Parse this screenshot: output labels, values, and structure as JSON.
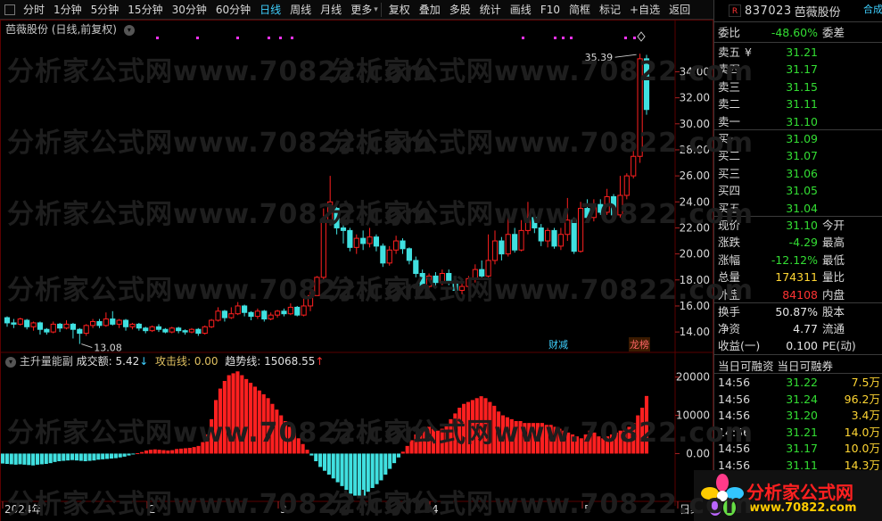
{
  "toolbar": {
    "left_items": [
      "分时",
      "1分钟",
      "5分钟",
      "15分钟",
      "30分钟",
      "60分钟",
      "日线",
      "周线",
      "月线",
      "更多"
    ],
    "active": "日线",
    "right_items": [
      "复权",
      "叠加",
      "多股",
      "统计",
      "画线",
      "F10",
      "简框",
      "标记",
      "+自选",
      "返回"
    ]
  },
  "chart": {
    "title": "芭薇股份 (日线,前复权)",
    "high_label": "35.39",
    "low_label": "13.08",
    "y_ticks": [
      "34.00",
      "32.00",
      "30.00",
      "28.00",
      "26.00",
      "24.00",
      "22.00",
      "20.00",
      "18.00",
      "16.00",
      "14.00"
    ],
    "x_ticks": [
      "2024年",
      "2",
      "3",
      "4",
      "5",
      "日线"
    ],
    "marker_cw": "财减",
    "marker_lb": "龙榜",
    "watermark": "分析家公式网www.70822.com"
  },
  "indicator": {
    "name": "主升量能副",
    "volume_label": "成交额:",
    "volume_value": "5.42",
    "attack_label": "攻击线:",
    "attack_value": "0.00",
    "trend_label": "趋势线:",
    "trend_value": "15068.55",
    "y_ticks": [
      "20000",
      "10000",
      "0.00"
    ]
  },
  "panel": {
    "badge": "R",
    "code": "837023",
    "name": "芭薇股份",
    "tag": "合成",
    "weibi_label": "委比",
    "weibi_value": "-48.60%",
    "weicha_label": "委差",
    "sells": [
      {
        "label": "卖五",
        "price": "31.21"
      },
      {
        "label": "卖四",
        "price": "31.17"
      },
      {
        "label": "卖三",
        "price": "31.15"
      },
      {
        "label": "卖二",
        "price": "31.11"
      },
      {
        "label": "卖一",
        "price": "31.10"
      }
    ],
    "sell5_currency": "¥",
    "buys": [
      {
        "label": "买一",
        "price": "31.09"
      },
      {
        "label": "买二",
        "price": "31.07"
      },
      {
        "label": "买三",
        "price": "31.06"
      },
      {
        "label": "买四",
        "price": "31.05"
      },
      {
        "label": "买五",
        "price": "31.04"
      }
    ],
    "stats": [
      {
        "label": "现价",
        "value": "31.10",
        "color": "green",
        "label2": "今开"
      },
      {
        "label": "涨跌",
        "value": "-4.29",
        "color": "green",
        "label2": "最高"
      },
      {
        "label": "涨幅",
        "value": "-12.12%",
        "color": "green",
        "label2": "最低"
      },
      {
        "label": "总量",
        "value": "174311",
        "color": "yellow",
        "label2": "量比"
      },
      {
        "label": "外盘",
        "value": "84108",
        "color": "red",
        "label2": "内盘"
      }
    ],
    "stats2": [
      {
        "label": "换手",
        "value": "50.87%",
        "color": "white",
        "label2": "股本"
      },
      {
        "label": "净资",
        "value": "4.77",
        "color": "white",
        "label2": "流通"
      },
      {
        "label": "收益(一)",
        "value": "0.100",
        "color": "white",
        "label2": "PE(动)"
      }
    ],
    "fin_head": "当日可融资 当日可融券",
    "ticks": [
      {
        "time": "14:56",
        "price": "31.22",
        "vol": "7.5万"
      },
      {
        "time": "14:56",
        "price": "31.24",
        "vol": "96.2万"
      },
      {
        "time": "14:56",
        "price": "31.20",
        "vol": "3.4万"
      },
      {
        "time": "14:56",
        "price": "31.21",
        "vol": "14.0万"
      },
      {
        "time": "14:56",
        "price": "31.17",
        "vol": "10.0万"
      },
      {
        "time": "14:56",
        "price": "31.11",
        "vol": "14.3万"
      }
    ],
    "logo_main": "分析家公式网",
    "logo_sub": "www.70822.com"
  },
  "colors": {
    "up": "#ff2020",
    "down": "#40e0e0",
    "bg": "#000000",
    "grid": "#3a0000"
  },
  "chart_data": {
    "type": "candlestick+bar",
    "price_range": [
      12.5,
      36.5
    ],
    "candles": [
      [
        15.1,
        14.7,
        15.2,
        14.4
      ],
      [
        14.7,
        14.6,
        15.0,
        14.3
      ],
      [
        14.6,
        15.0,
        15.1,
        14.5
      ],
      [
        14.9,
        14.4,
        15.0,
        14.2
      ],
      [
        14.4,
        14.7,
        14.8,
        14.1
      ],
      [
        14.7,
        14.2,
        14.8,
        13.8
      ],
      [
        14.2,
        14.0,
        14.3,
        13.8
      ],
      [
        14.0,
        14.6,
        14.8,
        13.9
      ],
      [
        14.6,
        14.3,
        14.7,
        14.0
      ],
      [
        14.3,
        14.6,
        14.9,
        14.2
      ],
      [
        14.6,
        14.2,
        14.7,
        13.5
      ],
      [
        14.2,
        13.9,
        14.3,
        13.08
      ],
      [
        13.9,
        14.5,
        14.6,
        13.7
      ],
      [
        14.5,
        14.8,
        15.0,
        14.3
      ],
      [
        14.8,
        14.5,
        15.0,
        14.3
      ],
      [
        14.5,
        15.0,
        15.5,
        14.4
      ],
      [
        15.0,
        14.6,
        15.6,
        14.5
      ],
      [
        14.6,
        14.9,
        15.0,
        14.3
      ],
      [
        14.9,
        14.4,
        15.0,
        14.1
      ],
      [
        14.4,
        14.6,
        14.7,
        14.2
      ],
      [
        14.6,
        14.3,
        14.7,
        14.1
      ],
      [
        14.3,
        14.1,
        14.4,
        13.9
      ],
      [
        14.1,
        14.4,
        14.5,
        14.0
      ],
      [
        14.4,
        14.2,
        14.6,
        14.0
      ],
      [
        14.2,
        14.0,
        14.3,
        13.9
      ],
      [
        14.0,
        14.3,
        14.4,
        13.9
      ],
      [
        14.3,
        14.1,
        14.4,
        13.9
      ],
      [
        14.1,
        14.0,
        14.2,
        13.8
      ],
      [
        14.0,
        14.2,
        14.3,
        13.9
      ],
      [
        14.2,
        13.9,
        14.3,
        13.7
      ],
      [
        13.9,
        14.4,
        14.5,
        13.8
      ],
      [
        14.4,
        14.9,
        15.0,
        14.3
      ],
      [
        14.9,
        15.6,
        15.9,
        14.8
      ],
      [
        15.6,
        15.1,
        15.7,
        14.8
      ],
      [
        15.1,
        15.4,
        15.9,
        15.0
      ],
      [
        15.4,
        16.0,
        16.3,
        15.3
      ],
      [
        16.0,
        15.5,
        16.1,
        15.2
      ],
      [
        15.5,
        15.2,
        15.6,
        14.9
      ],
      [
        15.2,
        15.6,
        15.8,
        15.0
      ],
      [
        15.6,
        15.0,
        15.7,
        14.8
      ],
      [
        15.0,
        15.3,
        15.5,
        14.9
      ],
      [
        15.3,
        15.6,
        15.7,
        15.1
      ],
      [
        15.6,
        15.4,
        15.8,
        15.2
      ],
      [
        15.4,
        15.9,
        16.2,
        15.3
      ],
      [
        15.9,
        15.3,
        16.0,
        15.2
      ],
      [
        15.3,
        16.0,
        16.6,
        15.2
      ],
      [
        16.0,
        16.8,
        17.2,
        15.6
      ],
      [
        16.8,
        18.2,
        18.3,
        16.8
      ],
      [
        18.2,
        22.5,
        23.5,
        18.0
      ],
      [
        22.5,
        24.0,
        26.0,
        22.2
      ],
      [
        23.5,
        22.0,
        23.6,
        21.5
      ],
      [
        22.0,
        21.8,
        22.3,
        20.8
      ],
      [
        21.8,
        20.5,
        22.0,
        20.2
      ],
      [
        20.5,
        21.2,
        21.5,
        20.0
      ],
      [
        21.2,
        20.8,
        21.8,
        20.3
      ],
      [
        20.8,
        21.3,
        22.0,
        20.5
      ],
      [
        21.3,
        20.6,
        21.5,
        20.2
      ],
      [
        20.6,
        19.3,
        20.8,
        19.0
      ],
      [
        19.3,
        20.3,
        20.6,
        19.1
      ],
      [
        20.3,
        21.0,
        21.4,
        20.0
      ],
      [
        21.0,
        20.4,
        21.2,
        20.0
      ],
      [
        20.4,
        19.5,
        20.5,
        19.2
      ],
      [
        19.5,
        18.5,
        19.8,
        18.2
      ],
      [
        18.5,
        17.5,
        18.8,
        17.2
      ],
      [
        17.5,
        18.3,
        18.5,
        17.3
      ],
      [
        18.3,
        17.8,
        18.6,
        17.5
      ],
      [
        17.8,
        18.5,
        18.8,
        17.6
      ],
      [
        18.5,
        17.9,
        18.8,
        17.6
      ],
      [
        17.9,
        17.2,
        18.0,
        17.0
      ],
      [
        17.2,
        17.5,
        17.8,
        16.9
      ],
      [
        17.5,
        18.1,
        18.3,
        17.2
      ],
      [
        18.1,
        18.8,
        19.2,
        17.8
      ],
      [
        18.8,
        18.3,
        19.5,
        18.0
      ],
      [
        18.3,
        19.5,
        21.5,
        18.0
      ],
      [
        19.5,
        21.0,
        21.8,
        19.2
      ],
      [
        21.0,
        20.0,
        21.3,
        19.5
      ],
      [
        20.0,
        21.5,
        23.2,
        19.8
      ],
      [
        21.5,
        20.3,
        22.0,
        20.1
      ],
      [
        20.3,
        21.8,
        22.6,
        20.2
      ],
      [
        21.8,
        22.8,
        24.0,
        21.5
      ],
      [
        22.8,
        22.0,
        23.0,
        21.6
      ],
      [
        22.0,
        21.0,
        22.3,
        20.6
      ],
      [
        21.0,
        21.8,
        22.0,
        20.5
      ],
      [
        21.8,
        20.6,
        22.0,
        20.4
      ],
      [
        20.6,
        21.5,
        22.0,
        20.3
      ],
      [
        21.5,
        22.6,
        24.3,
        21.0
      ],
      [
        22.6,
        20.2,
        22.8,
        20.0
      ],
      [
        20.2,
        23.5,
        24.0,
        20.1
      ],
      [
        23.5,
        22.8,
        24.2,
        22.5
      ],
      [
        22.8,
        23.8,
        24.2,
        22.5
      ],
      [
        23.8,
        23.2,
        24.2,
        23.0
      ],
      [
        23.2,
        24.4,
        25.0,
        23.0
      ],
      [
        24.4,
        23.0,
        24.6,
        22.5
      ],
      [
        23.0,
        24.5,
        26.0,
        22.8
      ],
      [
        24.5,
        26.0,
        26.2,
        24.2
      ],
      [
        26.0,
        27.5,
        28.5,
        25.8
      ],
      [
        27.5,
        35.0,
        35.39,
        27.0
      ],
      [
        35.0,
        31.1,
        35.3,
        30.7
      ]
    ],
    "volume_bars": [
      -2600,
      -2700,
      -2800,
      -2900,
      -2800,
      -2900,
      -3000,
      -3100,
      -2900,
      -2800,
      -2700,
      -2500,
      -2200,
      -2000,
      -1900,
      -1800,
      -1700,
      -1800,
      -1900,
      -2000,
      -1900,
      -1800,
      -1600,
      -1500,
      -1400,
      -1300,
      -1200,
      -1000,
      -800,
      -500,
      -200,
      100,
      400,
      800,
      1000,
      1100,
      1000,
      900,
      800,
      900,
      1200,
      1300,
      1400,
      1500,
      1700,
      2000,
      3000,
      5000,
      9000,
      14000,
      17000,
      19000,
      20500,
      21000,
      21500,
      20500,
      19500,
      18500,
      17500,
      16500,
      15500,
      14500,
      13000,
      11500,
      10000,
      8500,
      7000,
      5500,
      4000,
      2500,
      1000,
      -500,
      -2000,
      -3500,
      -4500,
      -5500,
      -6500,
      -7500,
      -8500,
      -9500,
      -10500,
      -11000,
      -11500,
      -11000,
      -10000,
      -9000,
      -8000,
      -7000,
      -5500,
      -4000,
      -2500,
      -1000,
      500,
      2000,
      3500,
      5000,
      6000,
      6500,
      7000,
      6500,
      6000,
      6500,
      7500,
      9000,
      10500,
      12000,
      13000,
      13500,
      14000,
      14500,
      15000,
      14500,
      13500,
      12500,
      11000,
      10000,
      9500,
      9000,
      8500,
      8500,
      8000,
      8000,
      8000,
      8000,
      8000,
      7500,
      7500,
      7000,
      6500,
      6000,
      5500,
      5000,
      4500,
      4000,
      5000,
      6000,
      5500,
      4500,
      4000,
      4500,
      5000,
      5500,
      6000,
      6500,
      7000,
      8000,
      10000,
      12000,
      15068
    ],
    "volume_range": [
      -12500,
      22500
    ]
  }
}
